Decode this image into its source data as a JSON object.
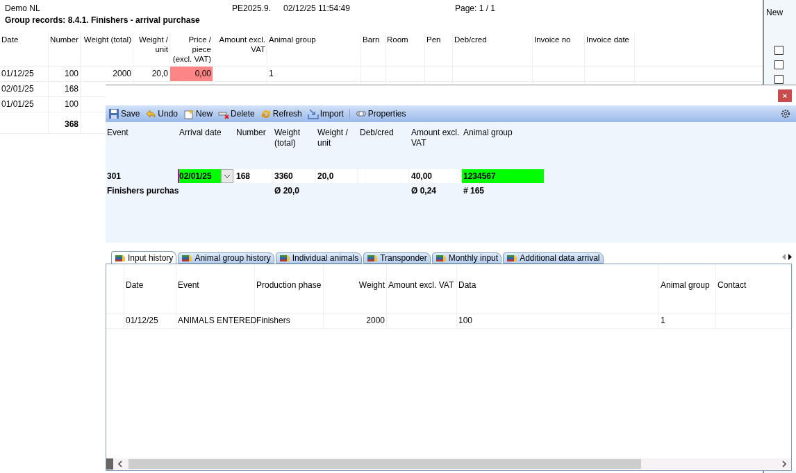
{
  "report": {
    "company": "Demo NL",
    "version": "PE2025.9.",
    "timestamp": "02/12/25 11:54:49",
    "page": "Page: 1 / 1",
    "title": "Group records: 8.4.1. Finishers - arrival purchase",
    "columns": [
      "Date",
      "Number",
      "Weight (total)",
      "Weight / unit",
      "Price / piece (excl. VAT)",
      "Amount excl. VAT",
      "Animal group",
      "Barn",
      "Room",
      "Pen",
      "Deb/cred",
      "Invoice no",
      "Invoice date"
    ],
    "rows": [
      {
        "cells": [
          "01/12/25",
          "100",
          "2000",
          "20,0",
          "0,00",
          "",
          "1"
        ],
        "price_alert": true
      },
      {
        "cells": [
          "02/01/25",
          "168"
        ]
      },
      {
        "cells": [
          "01/01/25",
          "100"
        ]
      }
    ],
    "total": "368"
  },
  "side_panel": {
    "header": "New",
    "checkboxes": [
      {
        "checked": false
      },
      {
        "checked": false
      },
      {
        "checked": false
      }
    ]
  },
  "dialog": {
    "close_label": "×",
    "toolbar": [
      {
        "label": "Save",
        "kind": "save"
      },
      {
        "label": "Undo",
        "kind": "undo"
      },
      {
        "label": "New",
        "kind": "new"
      },
      {
        "label": "Delete",
        "kind": "delete"
      },
      {
        "label": "Refresh",
        "kind": "refresh"
      },
      {
        "label": "Import",
        "kind": "import"
      },
      {
        "label": "Properties",
        "kind": "properties"
      }
    ],
    "form": {
      "columns": [
        "Event",
        "Arrival date",
        "Number",
        "Weight (total)",
        "Weight / unit",
        "Deb/cred",
        "Amount excl. VAT",
        "Animal group"
      ],
      "row": [
        {
          "kind": "label",
          "text": "301",
          "highlight": false
        },
        {
          "kind": "dropdown",
          "text": "02/01/25",
          "highlight": true
        },
        {
          "kind": "input",
          "text": "168",
          "highlight": false
        },
        {
          "kind": "input",
          "text": "3360",
          "highlight": false
        },
        {
          "kind": "input",
          "text": "20,0",
          "highlight": false
        },
        {
          "kind": "input",
          "highlight": false
        },
        {
          "kind": "input",
          "text": "40,00",
          "highlight": false
        },
        {
          "kind": "input",
          "text": "1234567",
          "highlight": true
        }
      ],
      "summary": {
        "event": "Finishers purchas",
        "weight_total": "Ø 20,0",
        "amount": "Ø 0,24",
        "animal_group": "# 165"
      }
    },
    "tabs": [
      {
        "label": "Input history",
        "selected": true
      },
      {
        "label": "Animal group history",
        "selected": false
      },
      {
        "label": "Individual animals",
        "selected": false
      },
      {
        "label": "Transponder",
        "selected": false
      },
      {
        "label": "Monthly input",
        "selected": false
      },
      {
        "label": "Additional data arrival",
        "selected": false
      }
    ],
    "history": {
      "columns": [
        "Date",
        "Event",
        "Production phase",
        "Weight",
        "Amount excl. VAT",
        "Data",
        "Animal group",
        "Contact"
      ],
      "rows": [
        {
          "date": "01/12/25",
          "event": "ANIMALS ENTERED",
          "phase": "Finishers",
          "weight": "2000",
          "data": "100",
          "animal_group": "1"
        }
      ]
    }
  }
}
